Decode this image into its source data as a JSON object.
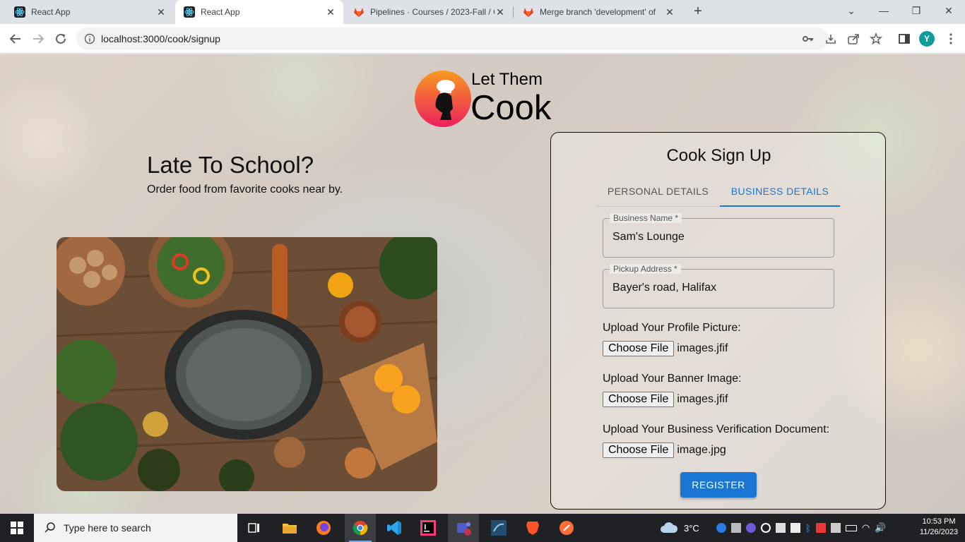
{
  "browser": {
    "tabs": [
      {
        "title": "React App",
        "active": false,
        "favicon": "react-icon"
      },
      {
        "title": "React App",
        "active": true,
        "favicon": "react-icon"
      },
      {
        "title": "Pipelines · Courses / 2023-Fall / C",
        "active": false,
        "favicon": "gitlab-icon"
      },
      {
        "title": "Merge branch 'development' of",
        "active": false,
        "favicon": "gitlab-icon"
      }
    ],
    "new_tab": "+",
    "url": "localhost:3000/cook/signup",
    "profile_initial": "Y"
  },
  "page": {
    "logo": {
      "top_text": "Let Them",
      "main_text": "Cook"
    },
    "headline": "Late To School?",
    "subline": "Order food from favorite cooks near by."
  },
  "signup": {
    "title": "Cook Sign Up",
    "tabs": [
      {
        "label": "PERSONAL DETAILS",
        "selected": false
      },
      {
        "label": "BUSINESS DETAILS",
        "selected": true
      }
    ],
    "fields": {
      "business_name": {
        "label": "Business Name *",
        "value": "Sam's Lounge"
      },
      "pickup_address": {
        "label": "Pickup Address *",
        "value": "Bayer's road, Halifax"
      }
    },
    "uploads": {
      "profile": {
        "label": "Upload Your Profile Picture:",
        "button": "Choose File",
        "file": "images.jfif"
      },
      "banner": {
        "label": "Upload Your Banner Image:",
        "button": "Choose File",
        "file": "images.jfif"
      },
      "verification": {
        "label": "Upload Your Business Verification Document:",
        "button": "Choose File",
        "file": "image.jpg"
      }
    },
    "register_label": "REGISTER",
    "accent_color": "#1976d2"
  },
  "taskbar": {
    "search_placeholder": "Type here to search",
    "weather": "3°C",
    "time": "10:53 PM",
    "date": "11/26/2023"
  }
}
